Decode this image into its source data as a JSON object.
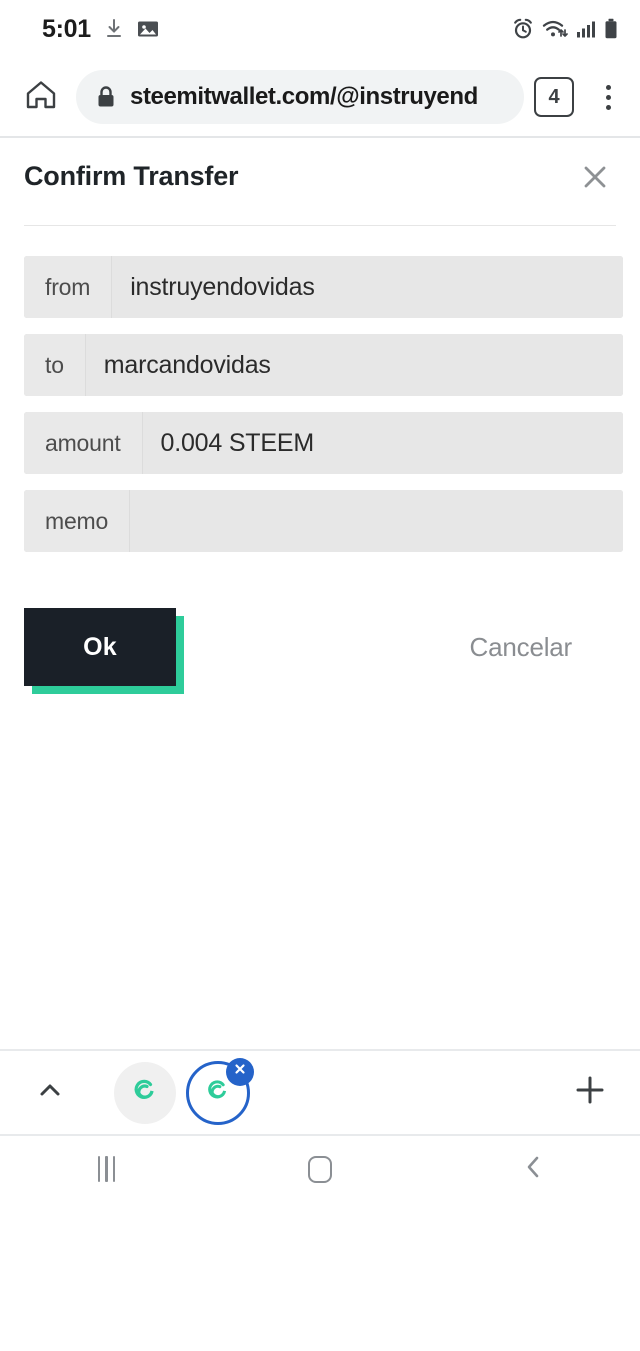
{
  "status_bar": {
    "time": "5:01",
    "left_icons": [
      "download-icon",
      "image-icon"
    ],
    "right_icons": [
      "alarm-icon",
      "wifi-icon",
      "signal-icon",
      "battery-icon"
    ]
  },
  "browser": {
    "home_icon": "home-icon",
    "lock_icon": "lock-icon",
    "url": "steemitwallet.com/@instruyend",
    "tab_count": "4",
    "menu_icon": "overflow-menu-icon"
  },
  "dialog": {
    "title": "Confirm Transfer",
    "close_icon": "close-icon",
    "fields": [
      {
        "label": "from",
        "value": "instruyendovidas"
      },
      {
        "label": "to",
        "value": "marcandovidas"
      },
      {
        "label": "amount",
        "value": "0.004 STEEM"
      },
      {
        "label": "memo",
        "value": ""
      }
    ],
    "confirm_label": "Ok",
    "cancel_label": "Cancelar",
    "colors": {
      "confirm_bg": "#1a2028",
      "confirm_shadow": "#2ecc9a",
      "cancel_text": "#8a8d91",
      "field_bg": "#e7e7e7"
    }
  },
  "tab_strip": {
    "expand_icon": "chevron-up-icon",
    "tabs": [
      {
        "icon": "steem-favicon",
        "selected": false
      },
      {
        "icon": "steem-favicon",
        "selected": true,
        "close_icon": "close-icon"
      }
    ],
    "new_tab_icon": "plus-icon",
    "accent": "#2563c9",
    "logo_color": "#2ecc9a"
  },
  "android_nav": {
    "recents_icon": "recents-icon",
    "home_icon": "home-icon",
    "back_icon": "back-icon"
  }
}
